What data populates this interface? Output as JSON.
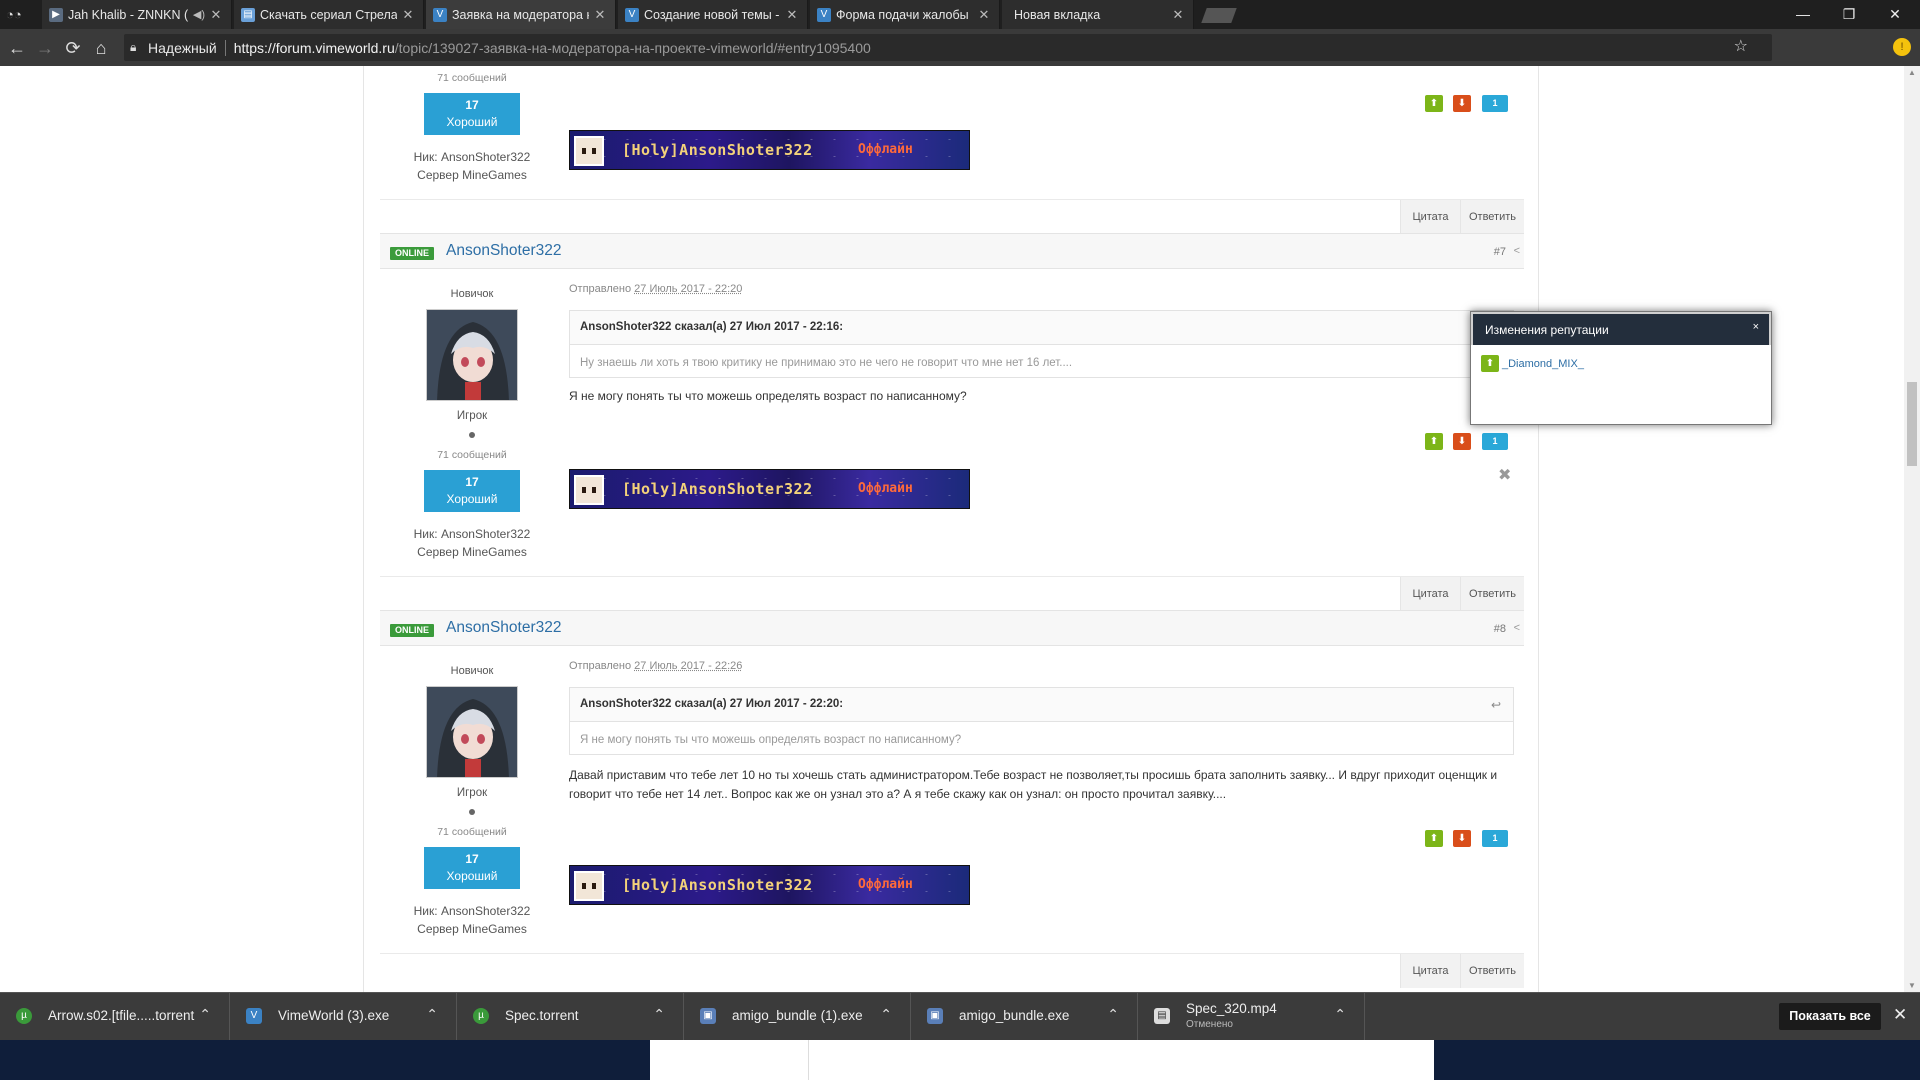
{
  "browser": {
    "tabs": [
      {
        "label": "Jah Khalib - ZNNKN (",
        "active": false
      },
      {
        "label": "Скачать сериал Стрела",
        "active": false
      },
      {
        "label": "Заявка на модератора н",
        "active": true
      },
      {
        "label": "Создание новой темы -",
        "active": false
      },
      {
        "label": "Форма подачи жалобы",
        "active": false
      },
      {
        "label": "Новая вкладка",
        "active": false
      }
    ],
    "secure_label": "Надежный",
    "url_host": "https://forum.vimeworld.ru",
    "url_path": "/topic/139027-заявка-на-модератора-на-проекте-vimeworld/#entry1095400"
  },
  "colors": {
    "online": "#3b9b3b",
    "author": "#2d6ea5",
    "rep": "#2aa0d4",
    "vote_up": "#7cb518",
    "vote_down": "#d94e1a"
  },
  "top_partial": {
    "msgs": "71 сообщений",
    "rep_value": "17",
    "rep_label": "Хороший",
    "nick_label": "Ник:",
    "nick": "AnsonShoter322",
    "server_label": "Сервер",
    "server": "MineGames",
    "vote_count": "1",
    "quote_btn": "Цитата",
    "reply_btn": "Ответить"
  },
  "banner": {
    "name": "[Holy]AnsonShoter322",
    "status": "Оффлайн"
  },
  "posts": [
    {
      "online": "ONLINE",
      "author": "AnsonShoter322",
      "num": "#7",
      "rank": "Новичок",
      "group": "Игрок",
      "msgs": "71 сообщений",
      "rep_value": "17",
      "rep_label": "Хороший",
      "nick_label": "Ник:",
      "nick": "AnsonShoter322",
      "server_label": "Сервер",
      "server": "MineGames",
      "posted_prefix": "Отправлено",
      "posted_date": "27 Июль 2017 - 22:20",
      "quote_head": "AnsonShoter322 сказал(а) 27 Июл 2017 - 22:16:",
      "quote_body": "Ну знаешь ли хоть я твою критику не принимаю это не чего не говорит что мне нет 16 лет....",
      "text": "Я не могу понять ты что можешь определять возраст по написанному?",
      "vote_count": "1",
      "quote_btn": "Цитата",
      "reply_btn": "Ответить"
    },
    {
      "online": "ONLINE",
      "author": "AnsonShoter322",
      "num": "#8",
      "rank": "Новичок",
      "group": "Игрок",
      "msgs": "71 сообщений",
      "rep_value": "17",
      "rep_label": "Хороший",
      "nick_label": "Ник:",
      "nick": "AnsonShoter322",
      "server_label": "Сервер",
      "server": "MineGames",
      "posted_prefix": "Отправлено",
      "posted_date": "27 Июль 2017 - 22:26",
      "quote_head": "AnsonShoter322 сказал(а) 27 Июл 2017 - 22:20:",
      "quote_body": "Я не могу понять ты что можешь определять возраст по написанному?",
      "text_line1": "Давай приставим что тебе лет 10 но ты хочешь стать администратором.Тебе возраст не позволяет,ты просишь брата заполнить заявку... И вдруг приходит оценщик и",
      "text_line2": "говорит что тебе нет 14 лет.. Вопрос как же он узнал это а? А я тебе скажу как он узнал: он просто прочитал заявку....",
      "vote_count": "1",
      "quote_btn": "Цитата",
      "reply_btn": "Ответить"
    }
  ],
  "rep_popup": {
    "title": "Изменения репутации",
    "close": "×",
    "user": "_Diamond_MIX_"
  },
  "downloads": [
    {
      "name": "Arrow.s02.[tfile.....torrent",
      "sub": ""
    },
    {
      "name": "VimeWorld (3).exe",
      "sub": ""
    },
    {
      "name": "Spec.torrent",
      "sub": ""
    },
    {
      "name": "amigo_bundle (1).exe",
      "sub": ""
    },
    {
      "name": "amigo_bundle.exe",
      "sub": ""
    },
    {
      "name": "Spec_320.mp4",
      "sub": "Отменено"
    }
  ],
  "show_all": "Показать все"
}
